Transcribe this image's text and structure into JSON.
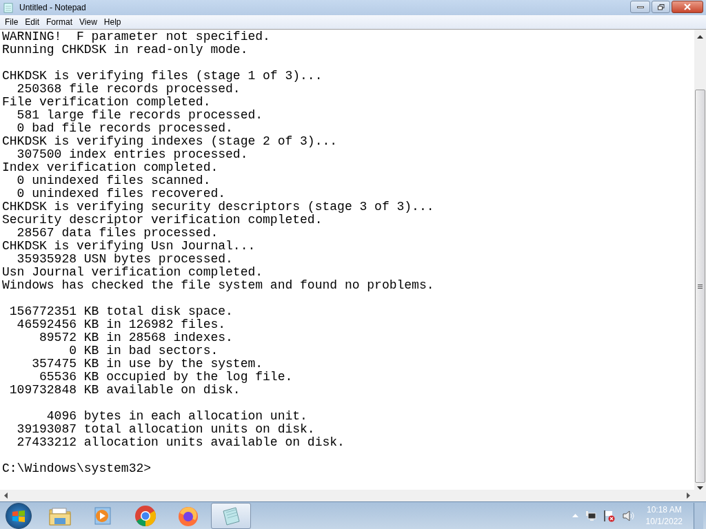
{
  "window": {
    "title": "Untitled - Notepad"
  },
  "menu": [
    "File",
    "Edit",
    "Format",
    "View",
    "Help"
  ],
  "editor": {
    "text": "WARNING!  F parameter not specified.\nRunning CHKDSK in read-only mode.\n\nCHKDSK is verifying files (stage 1 of 3)...\n  250368 file records processed.\nFile verification completed.\n  581 large file records processed.\n  0 bad file records processed.\nCHKDSK is verifying indexes (stage 2 of 3)...\n  307500 index entries processed.\nIndex verification completed.\n  0 unindexed files scanned.\n  0 unindexed files recovered.\nCHKDSK is verifying security descriptors (stage 3 of 3)...\nSecurity descriptor verification completed.\n  28567 data files processed.\nCHKDSK is verifying Usn Journal...\n  35935928 USN bytes processed.\nUsn Journal verification completed.\nWindows has checked the file system and found no problems.\n\n 156772351 KB total disk space.\n  46592456 KB in 126982 files.\n     89572 KB in 28568 indexes.\n         0 KB in bad sectors.\n    357475 KB in use by the system.\n     65536 KB occupied by the log file.\n 109732848 KB available on disk.\n\n      4096 bytes in each allocation unit.\n  39193087 total allocation units on disk.\n  27433212 allocation units available on disk.\n\nC:\\Windows\\system32>"
  },
  "taskbar": {
    "apps": [
      {
        "kind": "explorer",
        "selected": false
      },
      {
        "kind": "media",
        "selected": false
      },
      {
        "kind": "chrome",
        "selected": false
      },
      {
        "kind": "firefox",
        "selected": false
      },
      {
        "kind": "notepad",
        "selected": true
      }
    ]
  },
  "clock": {
    "time": "10:18 AM",
    "date": "10/1/2022"
  }
}
